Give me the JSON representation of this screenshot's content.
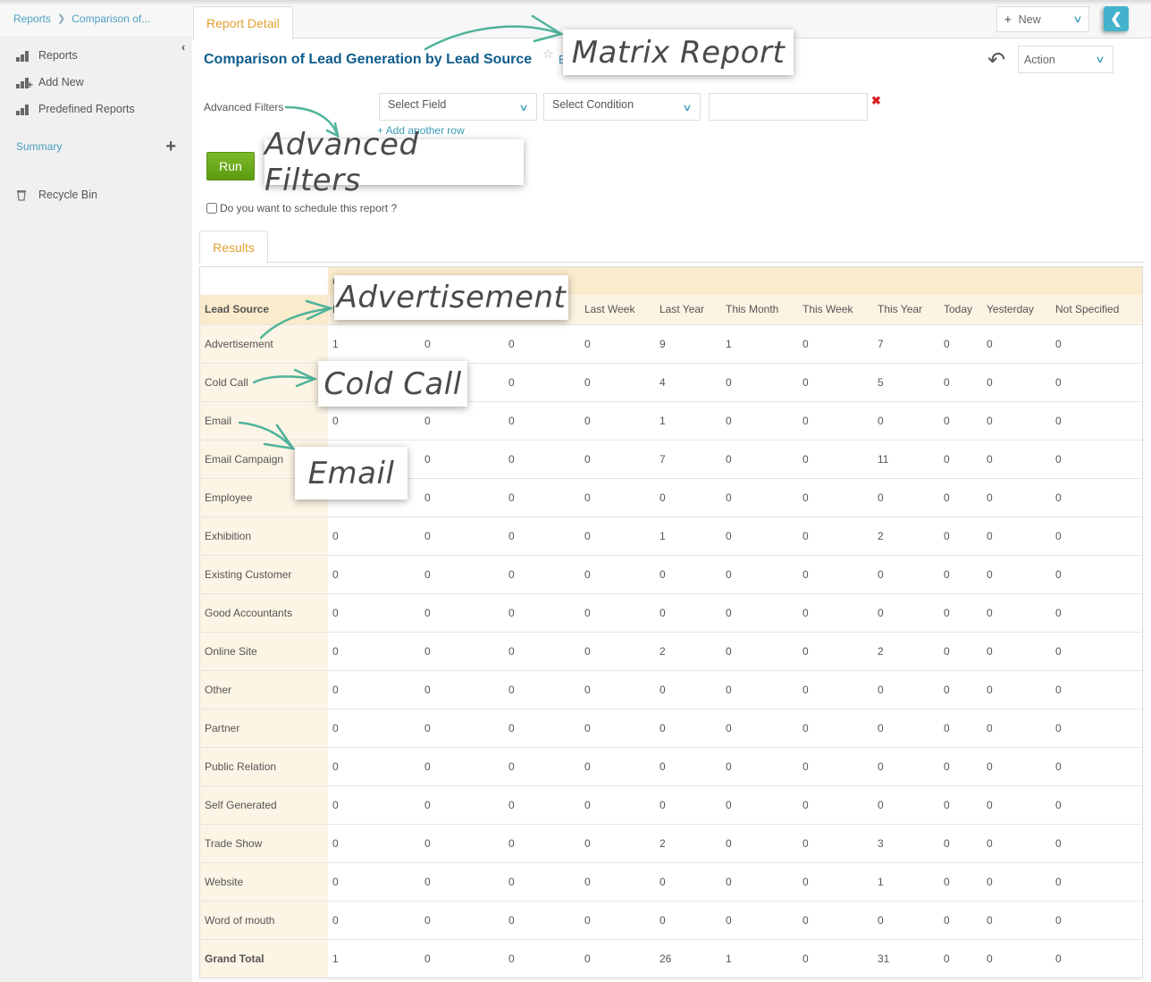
{
  "breadcrumb": {
    "root": "Reports",
    "current": "Comparison of..."
  },
  "sidebar": {
    "items": [
      {
        "label": "Reports",
        "icon": "bar-chart-icon"
      },
      {
        "label": "Add New",
        "icon": "bar-chart-add-icon"
      },
      {
        "label": "Predefined Reports",
        "icon": "bar-chart-icon"
      }
    ],
    "summary_label": "Summary",
    "recycle_label": "Recycle Bin"
  },
  "header": {
    "tab_label": "Report Detail",
    "new_label": "New",
    "title": "Comparison of Lead Generation by Lead Source",
    "edit_link": "E",
    "action_label": "Action"
  },
  "filters": {
    "label": "Advanced Filters",
    "field_placeholder": "Select Field",
    "condition_placeholder": "Select Condition",
    "value": "",
    "add_row_label": "+ Add another row",
    "run_label": "Run",
    "schedule_label": "Do you want to schedule this report ?"
  },
  "results": {
    "tab_label": "Results",
    "group_header": "C",
    "row_header": "Lead Source",
    "columns": [
      "L",
      "",
      "",
      "Last Week",
      "Last Year",
      "This Month",
      "This Week",
      "This Year",
      "Today",
      "Yesterday",
      "Not Specified"
    ],
    "rows": [
      {
        "label": "Advertisement",
        "values": [
          "1",
          "0",
          "0",
          "0",
          "9",
          "1",
          "0",
          "7",
          "0",
          "0",
          "0"
        ]
      },
      {
        "label": "Cold Call",
        "values": [
          "",
          "",
          "0",
          "0",
          "4",
          "0",
          "0",
          "5",
          "0",
          "0",
          "0"
        ]
      },
      {
        "label": "Email",
        "values": [
          "0",
          "0",
          "0",
          "0",
          "1",
          "0",
          "0",
          "0",
          "0",
          "0",
          "0"
        ]
      },
      {
        "label": "Email Campaign",
        "values": [
          "",
          "0",
          "0",
          "0",
          "7",
          "0",
          "0",
          "11",
          "0",
          "0",
          "0"
        ]
      },
      {
        "label": "Employee",
        "values": [
          "",
          "0",
          "0",
          "0",
          "0",
          "0",
          "0",
          "0",
          "0",
          "0",
          "0"
        ]
      },
      {
        "label": "Exhibition",
        "values": [
          "0",
          "0",
          "0",
          "0",
          "1",
          "0",
          "0",
          "2",
          "0",
          "0",
          "0"
        ]
      },
      {
        "label": "Existing Customer",
        "values": [
          "0",
          "0",
          "0",
          "0",
          "0",
          "0",
          "0",
          "0",
          "0",
          "0",
          "0"
        ]
      },
      {
        "label": "Good Accountants",
        "values": [
          "0",
          "0",
          "0",
          "0",
          "0",
          "0",
          "0",
          "0",
          "0",
          "0",
          "0"
        ]
      },
      {
        "label": "Online Site",
        "values": [
          "0",
          "0",
          "0",
          "0",
          "2",
          "0",
          "0",
          "2",
          "0",
          "0",
          "0"
        ]
      },
      {
        "label": "Other",
        "values": [
          "0",
          "0",
          "0",
          "0",
          "0",
          "0",
          "0",
          "0",
          "0",
          "0",
          "0"
        ]
      },
      {
        "label": "Partner",
        "values": [
          "0",
          "0",
          "0",
          "0",
          "0",
          "0",
          "0",
          "0",
          "0",
          "0",
          "0"
        ]
      },
      {
        "label": "Public Relation",
        "values": [
          "0",
          "0",
          "0",
          "0",
          "0",
          "0",
          "0",
          "0",
          "0",
          "0",
          "0"
        ]
      },
      {
        "label": "Self Generated",
        "values": [
          "0",
          "0",
          "0",
          "0",
          "0",
          "0",
          "0",
          "0",
          "0",
          "0",
          "0"
        ]
      },
      {
        "label": "Trade Show",
        "values": [
          "0",
          "0",
          "0",
          "0",
          "2",
          "0",
          "0",
          "3",
          "0",
          "0",
          "0"
        ]
      },
      {
        "label": "Website",
        "values": [
          "0",
          "0",
          "0",
          "0",
          "0",
          "0",
          "0",
          "1",
          "0",
          "0",
          "0"
        ]
      },
      {
        "label": "Word of mouth",
        "values": [
          "0",
          "0",
          "0",
          "0",
          "0",
          "0",
          "0",
          "0",
          "0",
          "0",
          "0"
        ]
      }
    ],
    "total": {
      "label": "Grand Total",
      "values": [
        "1",
        "0",
        "0",
        "0",
        "26",
        "1",
        "0",
        "31",
        "0",
        "0",
        "0"
      ]
    }
  },
  "callouts": {
    "matrix": "Matrix Report",
    "filters": "Advanced Filters",
    "advertisement": "Advertisement",
    "cold_call": "Cold Call",
    "email": "Email"
  },
  "colors": {
    "accent_blue": "#43b3cc",
    "title_blue": "#0e5c8c",
    "tab_orange": "#e0a030",
    "run_green": "#6aa91c",
    "arrow_teal": "#4fb39a",
    "remove_red": "#d42020"
  }
}
